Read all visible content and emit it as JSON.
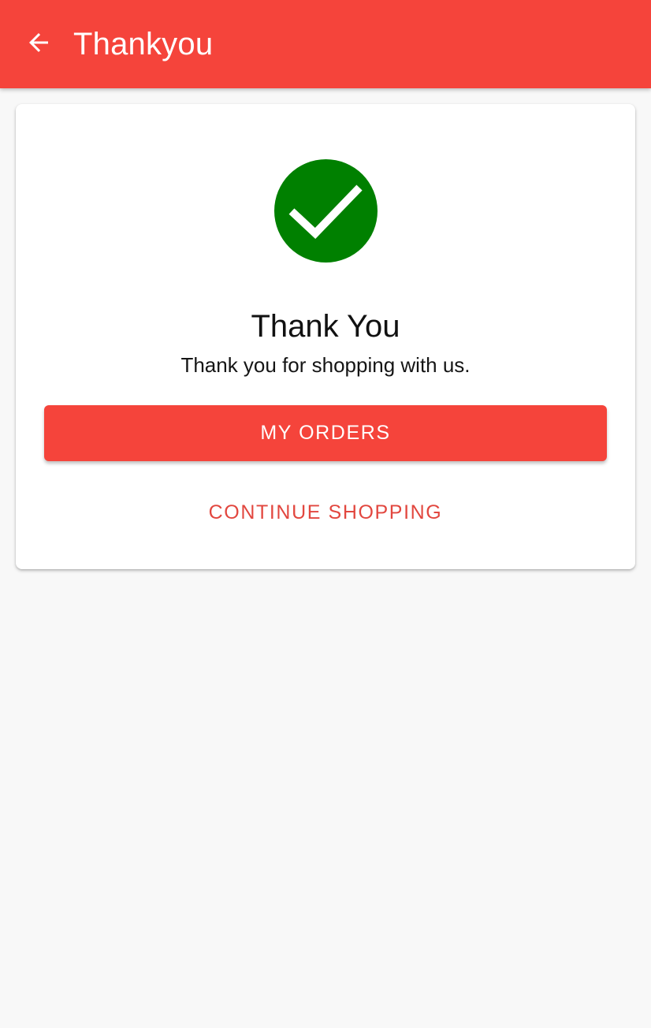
{
  "app_bar": {
    "title": "Thankyou",
    "back_icon": "arrow-left-icon",
    "background_color": "#f5443b"
  },
  "card": {
    "success_icon": "check-circle-icon",
    "success_color": "#008000",
    "heading": "Thank You",
    "message": "Thank you for shopping with us.",
    "primary_button_label": "MY ORDERS",
    "secondary_button_label": "CONTINUE SHOPPING"
  }
}
